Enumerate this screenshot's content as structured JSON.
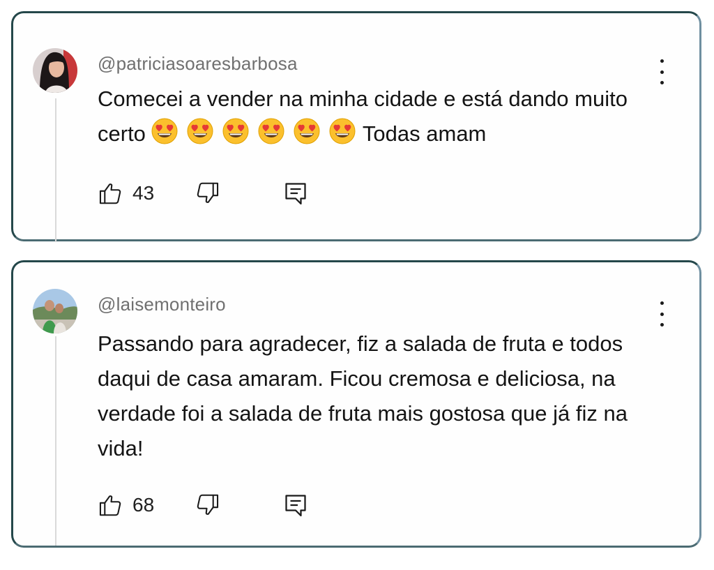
{
  "comments": [
    {
      "handle": "@patriciasoaresbarbosa",
      "text_before": "Comecei a vender na minha cidade e está dando muito certo",
      "emoji": "heart-eyes-emoji",
      "emoji_count": 6,
      "text_after": "Todas amam",
      "likes": "43",
      "avatar": "avatar-woman-dark-hair"
    },
    {
      "handle": "@laisemonteiro",
      "text": "Passando para agradecer, fiz a salada de fruta e todos daqui de casa amaram. Ficou cremosa e deliciosa, na verdade foi a salada de fruta mais gostosa que já fiz na vida!",
      "likes": "68",
      "avatar": "avatar-couple-outdoors"
    }
  ],
  "icons": {
    "like": "thumbs-up-icon",
    "dislike": "thumbs-down-icon",
    "reply": "reply-icon",
    "menu": "more-vert-icon"
  },
  "colors": {
    "border": "#24474a",
    "text": "#141414",
    "handle": "#707070"
  }
}
